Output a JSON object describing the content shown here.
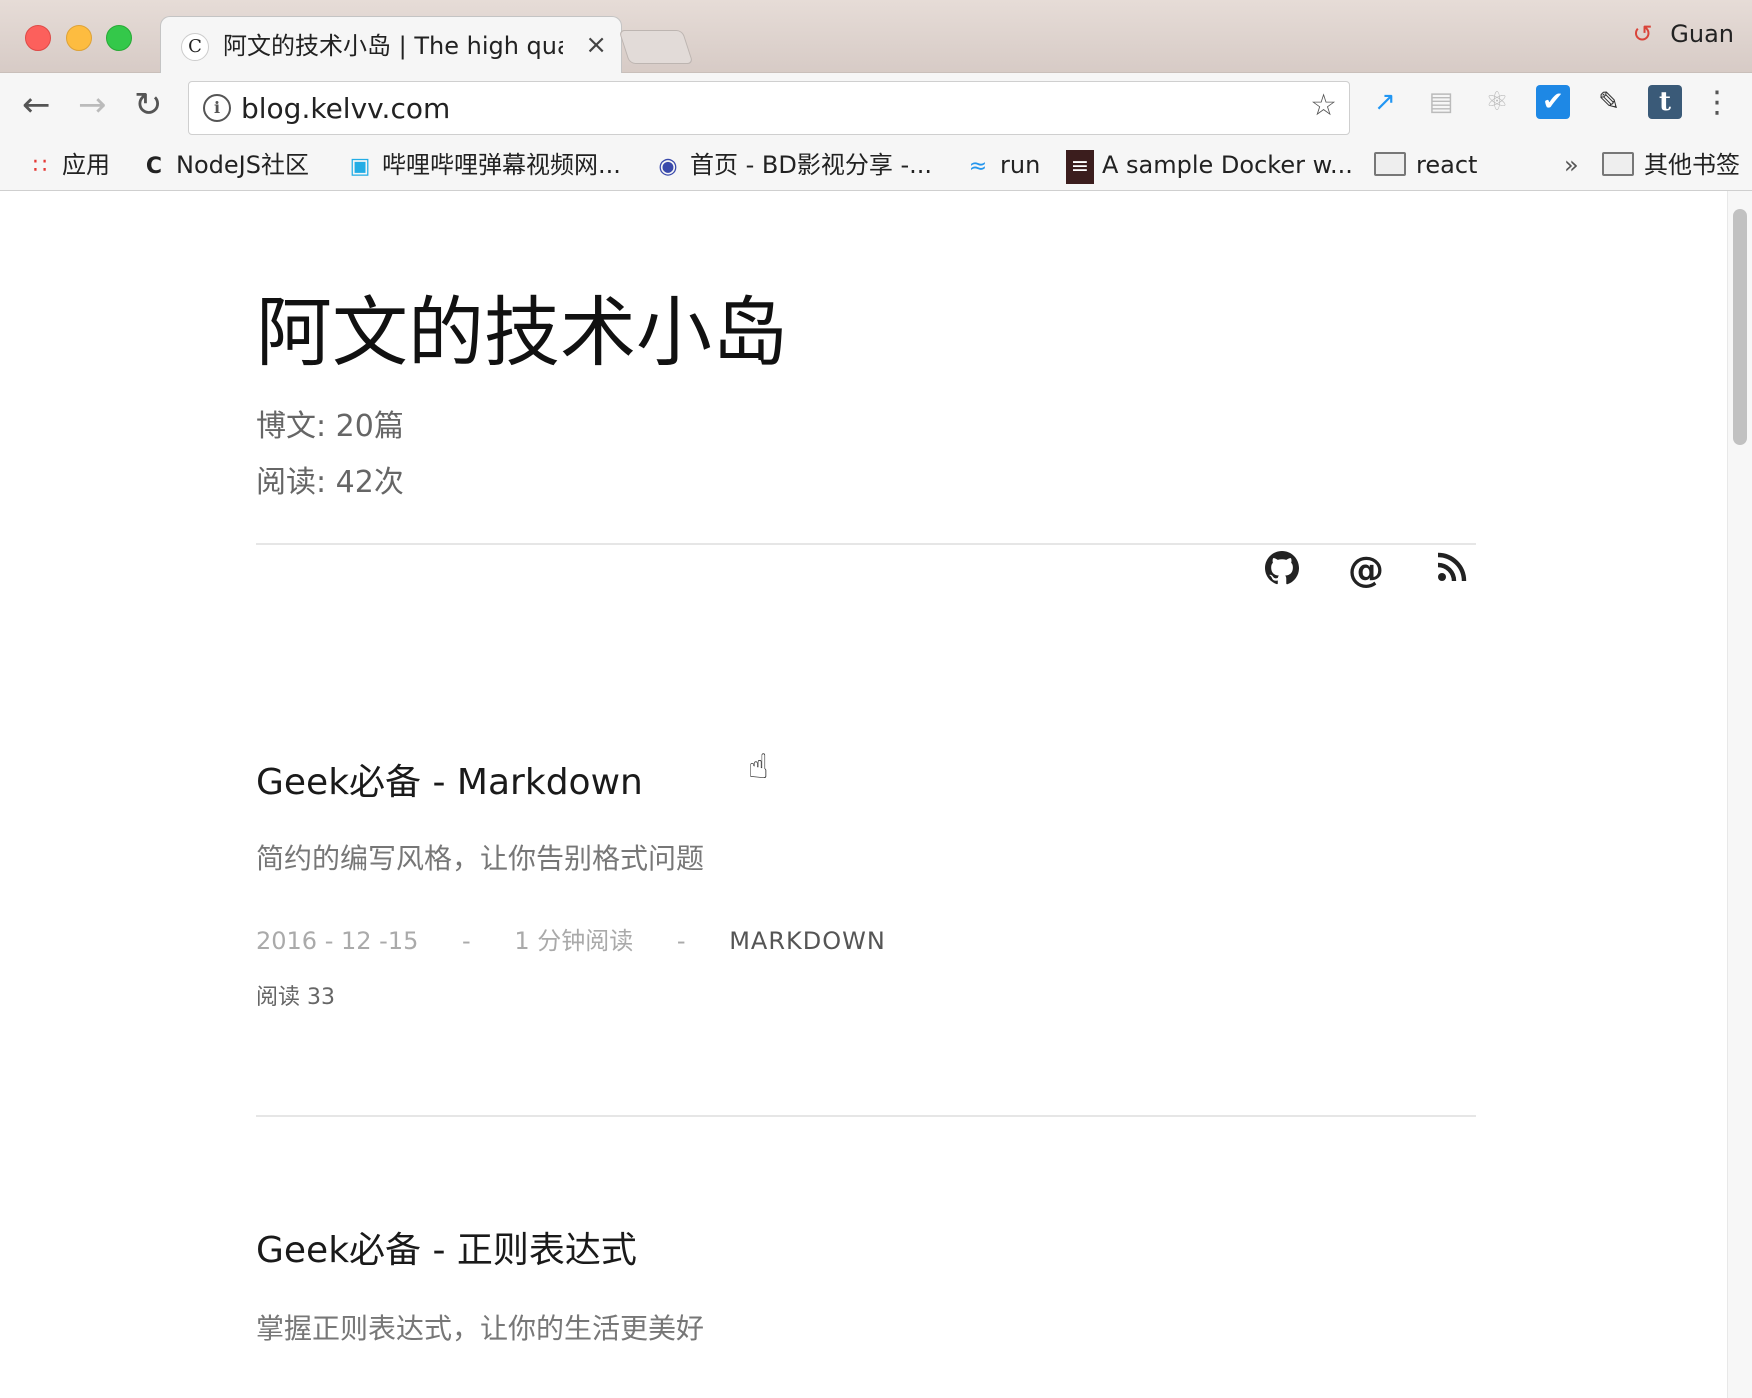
{
  "browser": {
    "tab_title": "阿文的技术小岛 | The high qual",
    "tab_favicon": "C",
    "tab_close": "×",
    "profile_name": "Guan",
    "url": "blog.kelvv.com",
    "bookmarks": [
      {
        "label": "应用",
        "icon": "apps-grid-icon"
      },
      {
        "label": "NodeJS社区",
        "icon": "nodejs-icon"
      },
      {
        "label": "哔哩哔哩弹幕视频网...",
        "icon": "bilibili-icon"
      },
      {
        "label": "首页 - BD影视分享 -...",
        "icon": "bd-icon"
      },
      {
        "label": "run",
        "icon": "docker-whale-icon"
      },
      {
        "label": "A sample Docker w...",
        "icon": "docker-sample-icon"
      },
      {
        "label": "react",
        "icon": "folder-icon"
      },
      {
        "label": "»",
        "icon": "chevron-more-icon"
      },
      {
        "label": "其他书签",
        "icon": "folder-icon"
      }
    ]
  },
  "site": {
    "title": "阿文的技术小岛",
    "posts_count": "博文: 20篇",
    "reads_count": "阅读: 42次",
    "social": [
      {
        "name": "github-icon"
      },
      {
        "name": "at-email-icon",
        "glyph": "@"
      },
      {
        "name": "rss-icon"
      }
    ]
  },
  "posts": [
    {
      "title": "Geek必备 - Markdown",
      "desc": "简约的编写风格，让你告别格式问题",
      "date": "2016 - 12 -15",
      "sep": "-",
      "read_time": "1 分钟阅读",
      "tag": "MARKDOWN",
      "reads": "阅读 33"
    },
    {
      "title": "Geek必备 - 正则表达式",
      "desc": "掌握正则表达式，让你的生活更美好"
    }
  ],
  "colors": {
    "close": "#fc605c",
    "minimize": "#fdbc40",
    "maximize": "#34c84a",
    "text_primary": "#111111",
    "text_muted": "#777777"
  }
}
